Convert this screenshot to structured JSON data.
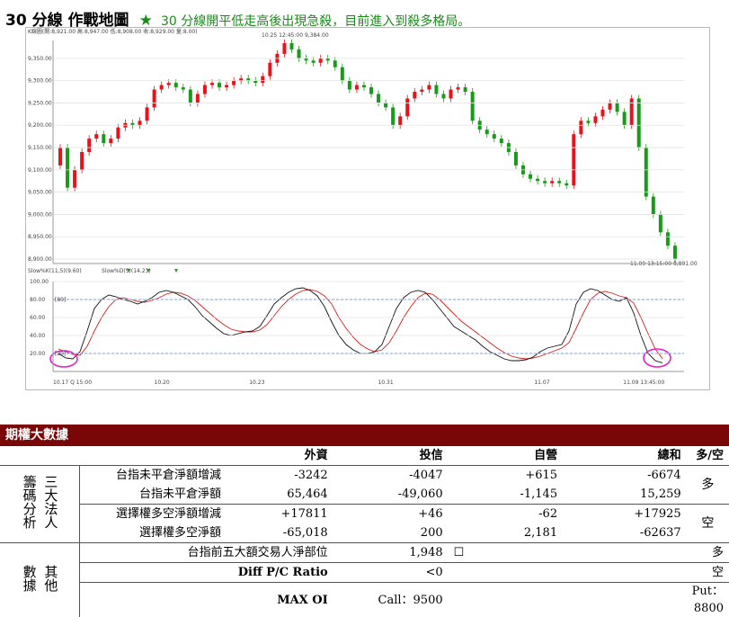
{
  "title": {
    "main": "30 分線 作戰地圖",
    "star": "★",
    "subtitle": "30 分線開平低走高後出現急殺，目前進入到殺多格局。"
  },
  "chart_data": [
    {
      "type": "candlestick",
      "header_text": "K線圖(開:8,921.00 高:8,947.00 低:8,908.00 收:8,929.00 量:8.00)",
      "y_ticks": [
        "9,350.00",
        "9,300.00",
        "9,250.00",
        "9,200.00",
        "9,150.00",
        "9,100.00",
        "9,050.00",
        "9,000.00",
        "8,950.00",
        "8,900.00"
      ],
      "ylim": [
        8890,
        9390
      ],
      "annotations": [
        "10.25 12:45:00 9,384.00",
        "11.09 13:15:00 8,891.00"
      ],
      "closes": [
        9150,
        9060,
        9100,
        9140,
        9170,
        9180,
        9160,
        9170,
        9195,
        9205,
        9200,
        9210,
        9240,
        9280,
        9290,
        9295,
        9285,
        9280,
        9250,
        9270,
        9290,
        9295,
        9285,
        9290,
        9300,
        9305,
        9300,
        9295,
        9310,
        9340,
        9360,
        9384,
        9370,
        9350,
        9345,
        9340,
        9350,
        9345,
        9330,
        9300,
        9280,
        9290,
        9285,
        9270,
        9250,
        9240,
        9200,
        9220,
        9260,
        9275,
        9280,
        9290,
        9270,
        9260,
        9280,
        9285,
        9275,
        9210,
        9190,
        9180,
        9170,
        9160,
        9140,
        9110,
        9090,
        9080,
        9075,
        9070,
        9075,
        9070,
        9065,
        9180,
        9210,
        9205,
        9220,
        9235,
        9250,
        9230,
        9200,
        9260,
        9150,
        9040,
        9000,
        8960,
        8930,
        8900
      ]
    },
    {
      "type": "line",
      "legend": [
        {
          "name": "Slow%K(11,5)(9.60)"
        },
        {
          "name": "Slow%D(5)(14.23)"
        }
      ],
      "y_ticks": [
        "100.00",
        "80.00",
        "60.00",
        "40.00",
        "20.00"
      ],
      "ylim": [
        0,
        100
      ],
      "ref_lines": [
        "[80]",
        "[20]"
      ],
      "x_ticks": [
        "10.17 Q 15:00",
        "10.20",
        "10.23",
        "10.31",
        "11.07",
        "11.09 13:45:00"
      ],
      "k": [
        20,
        15,
        14,
        22,
        45,
        70,
        80,
        85,
        83,
        80,
        78,
        75,
        78,
        82,
        88,
        90,
        88,
        84,
        80,
        72,
        62,
        55,
        48,
        42,
        40,
        42,
        44,
        45,
        50,
        62,
        75,
        82,
        88,
        92,
        93,
        90,
        84,
        72,
        55,
        40,
        30,
        24,
        20,
        20,
        22,
        30,
        50,
        70,
        82,
        88,
        90,
        88,
        80,
        70,
        60,
        50,
        45,
        40,
        35,
        28,
        22,
        18,
        14,
        12,
        12,
        13,
        16,
        22,
        26,
        28,
        30,
        45,
        75,
        88,
        92,
        90,
        85,
        80,
        78,
        82,
        65,
        40,
        20,
        12,
        9.6
      ],
      "d": [
        25,
        22,
        19,
        18,
        28,
        45,
        60,
        72,
        80,
        82,
        80,
        78,
        77,
        79,
        82,
        86,
        88,
        87,
        84,
        79,
        72,
        65,
        58,
        52,
        47,
        45,
        44,
        44,
        46,
        52,
        62,
        72,
        80,
        86,
        90,
        91,
        89,
        84,
        75,
        60,
        48,
        38,
        30,
        25,
        22,
        24,
        32,
        45,
        60,
        72,
        82,
        87,
        86,
        80,
        72,
        64,
        56,
        50,
        44,
        38,
        32,
        26,
        21,
        17,
        15,
        14,
        15,
        17,
        20,
        23,
        26,
        32,
        48,
        65,
        80,
        87,
        89,
        87,
        84,
        82,
        76,
        60,
        42,
        25,
        14.23
      ]
    }
  ],
  "table": {
    "header": "期權大數據",
    "columns": [
      "外資",
      "投信",
      "自營",
      "總和",
      "多/空"
    ],
    "group1_label": "三大法人",
    "group1_sub": "籌碼分析",
    "rows1": [
      {
        "label": "台指未平倉淨額增減",
        "v": [
          "-3242",
          "-4047",
          "+615",
          "-6674"
        ]
      },
      {
        "label": "台指未平倉淨額",
        "v": [
          "65,464",
          "-49,060",
          "-1,145",
          "15,259"
        ]
      },
      {
        "label": "選擇權多空淨額增減",
        "v": [
          "+17811",
          "+46",
          "-62",
          "+17925"
        ]
      },
      {
        "label": "選擇權多空淨額",
        "v": [
          "-65,018",
          "200",
          "2,181",
          "-62637"
        ]
      }
    ],
    "signal1": "多",
    "signal2": "空",
    "group2_label": "其他",
    "group2_sub": "數據",
    "rows2": [
      {
        "label": "台指前五大額交易人淨部位",
        "value": "1,948",
        "box": "☐",
        "signal": "多"
      },
      {
        "label": "Diff P/C Ratio",
        "value": "<0",
        "signal": "空"
      },
      {
        "label": "MAX OI",
        "value": "Call：9500",
        "put": "Put：8800"
      }
    ]
  },
  "colors": {
    "up": "#e8121b",
    "down": "#1a9a1a",
    "k_line": "#111111",
    "d_line": "#d81e1e",
    "ref": "#5b8fd1",
    "circle": "#e020d0",
    "header_bg": "#7a0707"
  }
}
